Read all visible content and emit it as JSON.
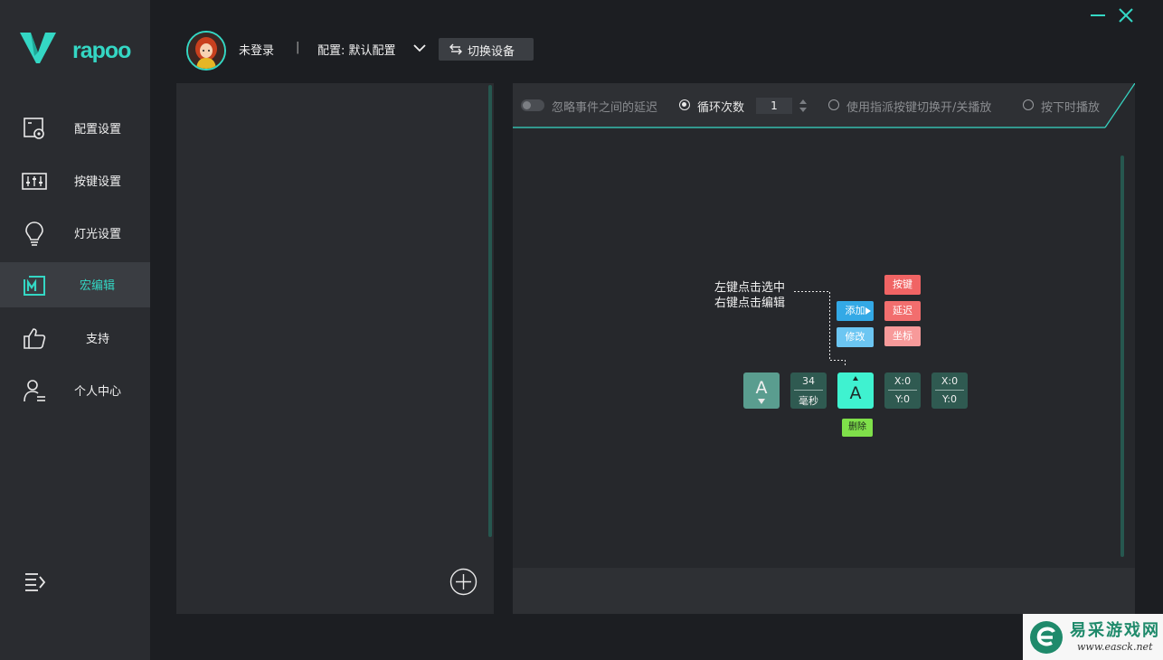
{
  "app": {
    "brand": "rapoo"
  },
  "colors": {
    "accent": "#34d7c4",
    "sidebar_bg": "#2a2c30",
    "chip_blue": "#33a9e6",
    "chip_red": "#f06464",
    "chip_green": "#7fe04a"
  },
  "window": {
    "minimize_icon": "minimize-icon",
    "close_icon": "close-icon"
  },
  "sidebar": {
    "items": [
      {
        "label": "配置设置",
        "icon": "profile-settings-icon"
      },
      {
        "label": "按键设置",
        "icon": "key-settings-icon"
      },
      {
        "label": "灯光设置",
        "icon": "lightbulb-icon"
      },
      {
        "label": "宏编辑",
        "icon": "macro-icon",
        "active": true
      },
      {
        "label": "支持",
        "icon": "thumbs-up-icon"
      },
      {
        "label": "个人中心",
        "icon": "user-center-icon"
      }
    ]
  },
  "header": {
    "login_status": "未登录",
    "separator": "|",
    "profile_label": "配置: 默认配置",
    "switch_device": "切换设备"
  },
  "toolbar": {
    "ignore_delay": "忽略事件之间的延迟",
    "loop_count_label": "循环次数",
    "loop_count_value": "1",
    "assigned_key_toggle": "使用指派按键切换开/关播放",
    "play_while_pressed": "按下时播放"
  },
  "legend": {
    "hint_line1": "左键点击选中",
    "hint_line2": "右键点击编辑",
    "add_label": "添加",
    "modify_label": "修改",
    "key_label": "按键",
    "delay_label": "延迟",
    "coord_label": "坐标",
    "delete_label": "删除",
    "key_down_char": "A",
    "delay_value": "34",
    "delay_unit": "毫秒",
    "key_up_char": "A",
    "coord1_x": "X:0",
    "coord1_y": "Y:0",
    "coord2_x": "X:0",
    "coord2_y": "Y:0"
  },
  "watermark": {
    "title": "易采游戏网",
    "url": "www.easck.net"
  }
}
